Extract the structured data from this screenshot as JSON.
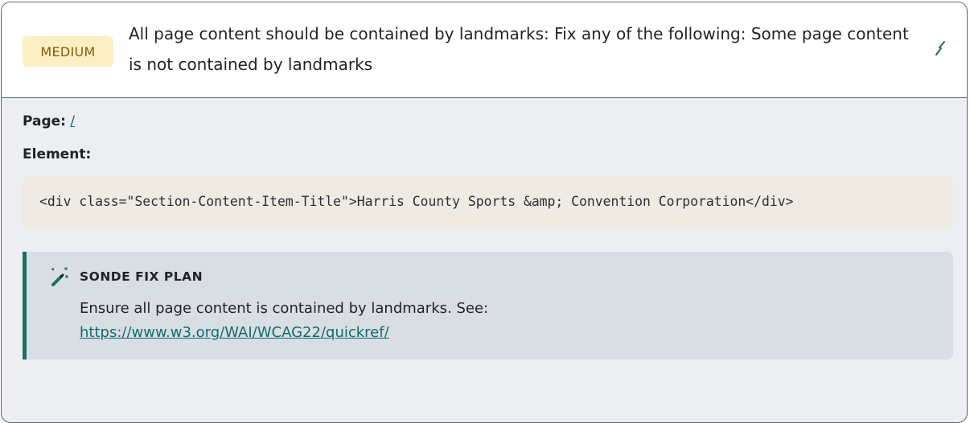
{
  "issue": {
    "severity": "MEDIUM",
    "title": "All page content should be contained by landmarks: Fix any of the following: Some page content is not contained by landmarks",
    "edit_icon": "wand-icon",
    "colors": {
      "severity_bg": "#fbf0c4",
      "severity_text": "#8a5a00",
      "accent": "#1f6e64",
      "link": "#116b6e"
    }
  },
  "details": {
    "page_label": "Page:",
    "page_value": "/",
    "element_label": "Element:",
    "element_code": "<div class=\"Section-Content-Item-Title\">Harris County Sports &amp; Convention Corporation</div>"
  },
  "fix_plan": {
    "icon": "magic-wand-sparkles-icon",
    "heading": "SONDE FIX PLAN",
    "text": "Ensure all page content is contained by landmarks. See:",
    "link": "https://www.w3.org/WAI/WCAG22/quickref/"
  }
}
